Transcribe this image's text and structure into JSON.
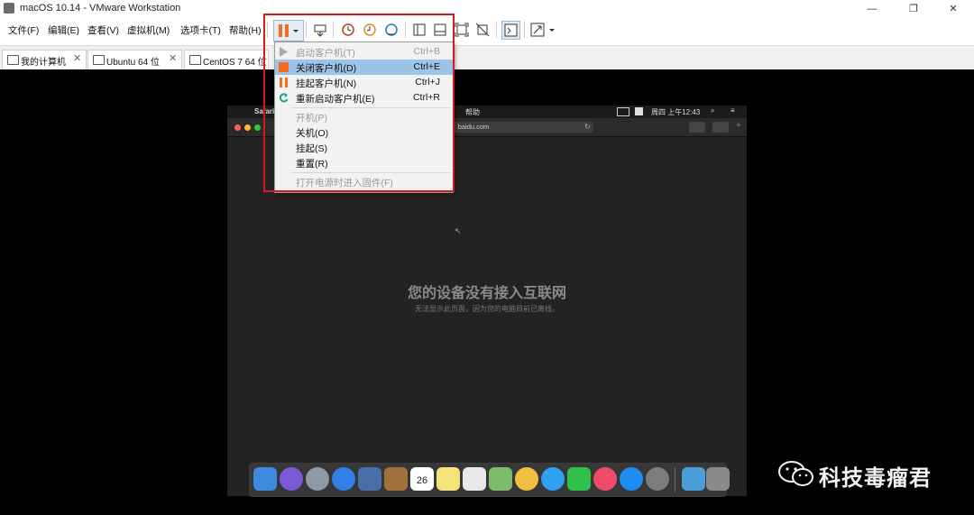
{
  "window": {
    "title": "macOS 10.14 - VMware Workstation",
    "controls": [
      "—",
      "❐",
      "✕"
    ]
  },
  "menu": [
    "文件(F)",
    "编辑(E)",
    "查看(V)",
    "虚拟机(M)",
    "选项卡(T)",
    "帮助(H)"
  ],
  "tabs": [
    {
      "label": "我的计算机",
      "close": "✕"
    },
    {
      "label": "Ubuntu 64 位",
      "close": "✕"
    },
    {
      "label": "CentOS 7 64 位",
      "close": "✕"
    }
  ],
  "power_menu": {
    "items": [
      {
        "label": "启动客户机(T)",
        "shortcut": "Ctrl+B",
        "disabled": true,
        "icon": "play-icon"
      },
      {
        "label": "关闭客户机(D)",
        "shortcut": "Ctrl+E",
        "selected": true,
        "icon": "stop-icon"
      },
      {
        "label": "挂起客户机(N)",
        "shortcut": "Ctrl+J",
        "icon": "pause-icon"
      },
      {
        "label": "重新启动客户机(E)",
        "shortcut": "Ctrl+R",
        "icon": "restart-icon"
      }
    ],
    "section2": [
      {
        "label": "开机(P)",
        "disabled": true
      },
      {
        "label": "关机(O)"
      },
      {
        "label": "挂起(S)"
      },
      {
        "label": "重置(R)"
      }
    ],
    "firmware": {
      "label": "打开电源时进入固件(F)",
      "disabled": true
    }
  },
  "guest": {
    "menubar": {
      "app": "Safari",
      "help": "帮助",
      "clock": "周四 上午12:43"
    },
    "url": "baidu.com",
    "offline_title": "您的设备没有接入互联网",
    "offline_subtitle": "无法显示此页面，因为您的电脑目前已离线。",
    "calendar_day": "26"
  },
  "watermark": "科技毒瘤君",
  "colors": {
    "accent_red": "#d9181e",
    "pause_orange": "#f26c21",
    "menu_selected": "#9cc3e8",
    "restart_teal": "#1aa78a"
  }
}
